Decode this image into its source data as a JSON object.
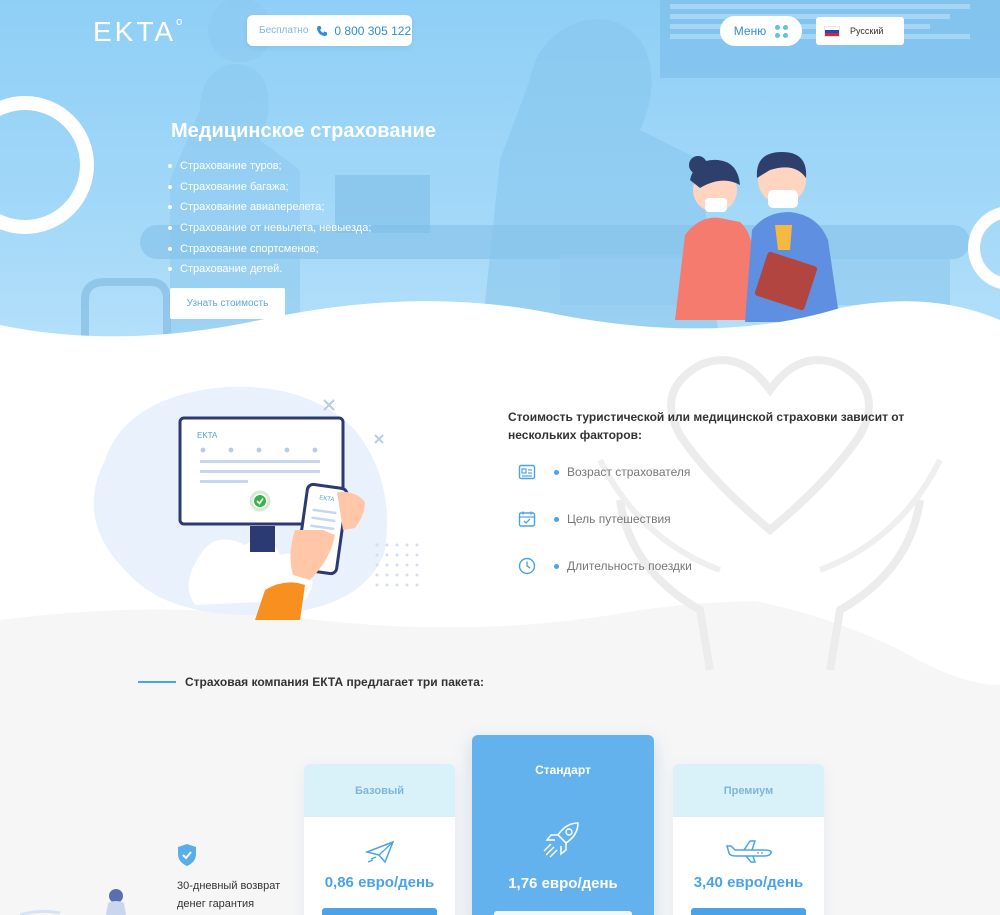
{
  "header": {
    "logo": "EKTA",
    "logo_mark": "o",
    "phone_label": "Бесплатно",
    "phone_number": "0 800 305 122",
    "menu_label": "Меню",
    "language": "Русский"
  },
  "hero": {
    "title": "Медицинское страхование",
    "list": [
      "Страхование туров;",
      "Страхование багажа;",
      "Страхование авиаперелета;",
      "Страхование от невылета, невыезда;",
      "Страхование спортсменов;",
      "Страхование детей."
    ],
    "cta": "Узнать стоимость"
  },
  "illustration": {
    "monitor_logo": "EKTA",
    "phone_logo": "EKTA"
  },
  "factors": {
    "title": "Стоимость туристической или медицинской страховки зависит от нескольких факторов:",
    "items": [
      {
        "label": "Возраст страхователя",
        "icon": "id-card-icon"
      },
      {
        "label": "Цель путешествия",
        "icon": "calendar-check-icon"
      },
      {
        "label": "Длительность поездки",
        "icon": "clock-icon"
      }
    ]
  },
  "packages": {
    "heading": "Страховая компания ЕКТА предлагает три пакета:",
    "guarantee": "30-дневный возврат денег гарантия",
    "cards": [
      {
        "name": "Базовый",
        "price": "0,86 евро/день",
        "icon": "paper-plane-icon"
      },
      {
        "name": "Стандарт",
        "price": "1,76 евро/день",
        "icon": "rocket-icon"
      },
      {
        "name": "Премиум",
        "price": "3,40 евро/день",
        "icon": "airplane-icon"
      }
    ]
  },
  "colors": {
    "hero_bg": "#8fcff6",
    "accent": "#4aa3e8",
    "card_head": "#d9f1f8",
    "standard_card": "#63b2ee"
  }
}
